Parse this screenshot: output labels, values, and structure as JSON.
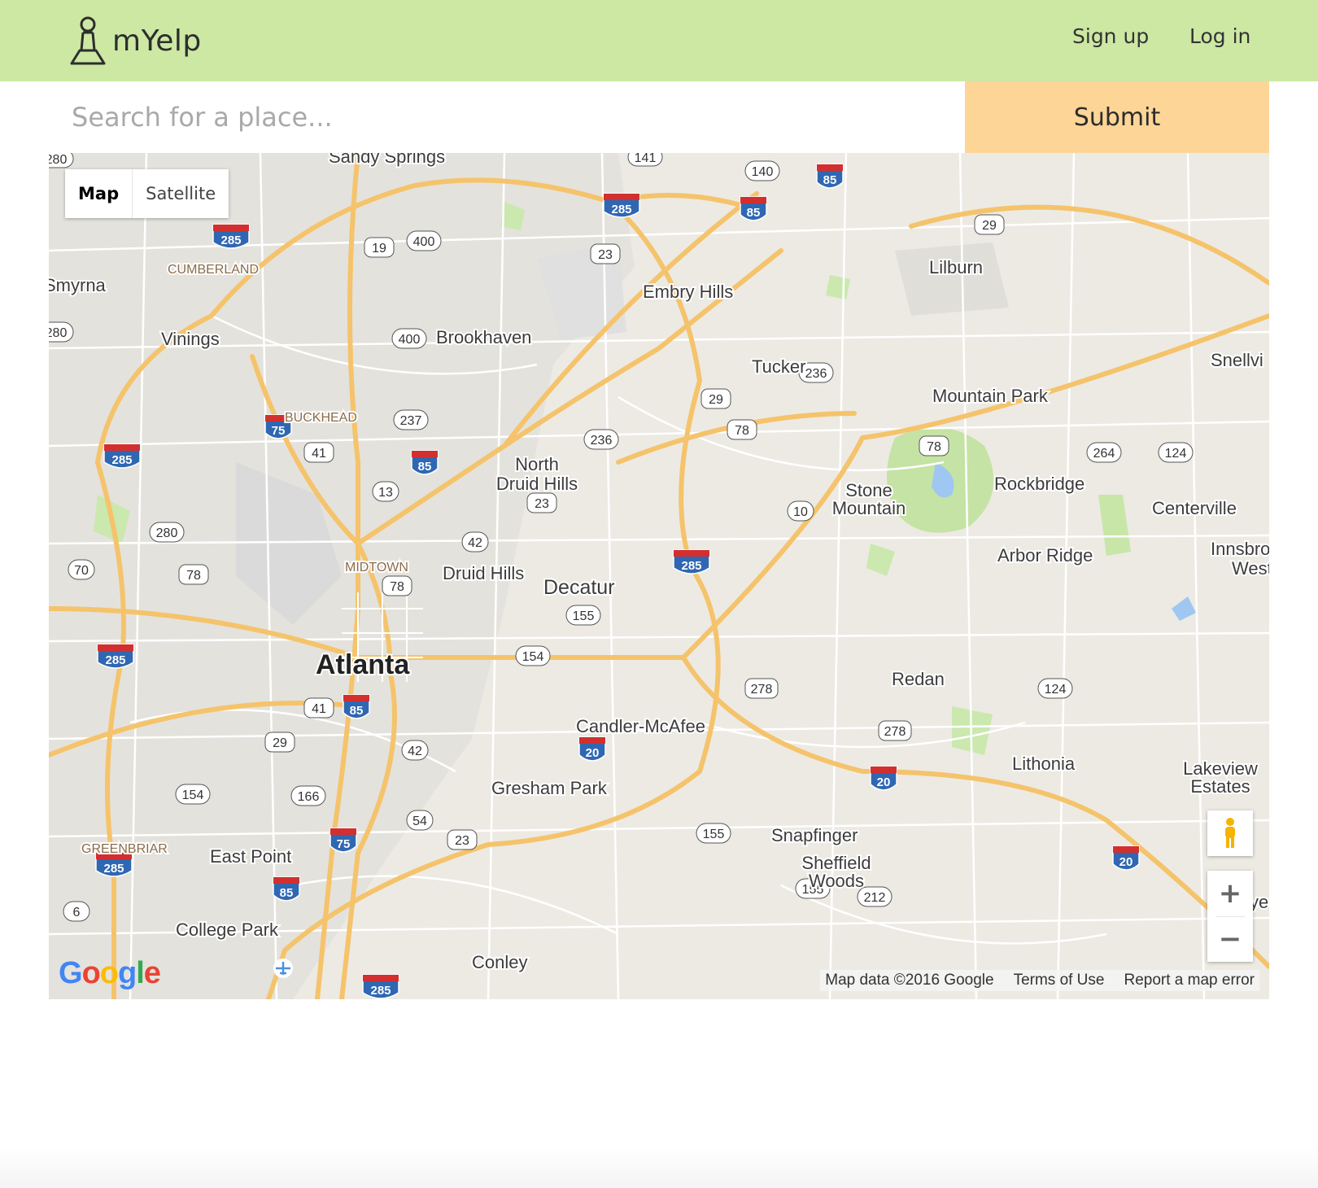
{
  "navbar": {
    "brand": "mYelp",
    "sign_up": "Sign up",
    "log_in": "Log in",
    "background_color": "#cce8a3"
  },
  "search": {
    "placeholder": "Search for a place...",
    "value": "",
    "submit_label": "Submit",
    "submit_color": "#fdd597"
  },
  "map": {
    "type_controls": {
      "map": "Map",
      "satellite": "Satellite",
      "active": "Map"
    },
    "zoom_in": "+",
    "zoom_out": "−",
    "google_logo": "Google",
    "attribution": {
      "data": "Map data ©2016 Google",
      "terms": "Terms of Use",
      "report": "Report a map error"
    },
    "places": {
      "sandy_springs": "Sandy Springs",
      "cumberland": "CUMBERLAND",
      "smyrna": "Smyrna",
      "vinings": "Vinings",
      "brookhaven": "Brookhaven",
      "embry_hills": "Embry Hills",
      "lilburn": "Lilburn",
      "tucker": "Tucker",
      "mountain_park": "Mountain Park",
      "snellville": "Snellvi",
      "buckhead": "BUCKHEAD",
      "north_druid_hills_1": "North",
      "north_druid_hills_2": "Druid Hills",
      "stone_mountain_1": "Stone",
      "stone_mountain_2": "Mountain",
      "rockbridge": "Rockbridge",
      "centerville": "Centerville",
      "arbor_ridge": "Arbor Ridge",
      "innsbrook_1": "Innsbro",
      "innsbrook_2": "West",
      "midtown": "MIDTOWN",
      "druid_hills": "Druid Hills",
      "decatur": "Decatur",
      "atlanta": "Atlanta",
      "redan": "Redan",
      "candler_mcafee": "Candler-McAfee",
      "lithonia": "Lithonia",
      "lakeview_1": "Lakeview",
      "lakeview_2": "Estates",
      "gresham_park": "Gresham Park",
      "greenbriar": "GREENBRIAR",
      "east_point": "East Point",
      "snapfinger": "Snapfinger",
      "sheffield_1": "Sheffield",
      "sheffield_2": "Woods",
      "college_park": "College Park",
      "conley": "Conley",
      "edge_ye": "ye"
    },
    "interstate_shields": [
      "285",
      "285",
      "285",
      "285",
      "285",
      "285",
      "285",
      "285",
      "85",
      "85",
      "85",
      "85",
      "85",
      "75",
      "75",
      "20",
      "20",
      "20"
    ],
    "highway_shields": [
      "141",
      "140",
      "19",
      "400",
      "23",
      "29",
      "400",
      "236",
      "237",
      "29",
      "41",
      "78",
      "236",
      "13",
      "23",
      "10",
      "78",
      "264",
      "124",
      "280",
      "42",
      "70",
      "78",
      "78",
      "155",
      "154",
      "278",
      "124",
      "41",
      "29",
      "42",
      "278",
      "154",
      "166",
      "54",
      "23",
      "155",
      "155",
      "212",
      "6",
      "280",
      "280"
    ]
  }
}
